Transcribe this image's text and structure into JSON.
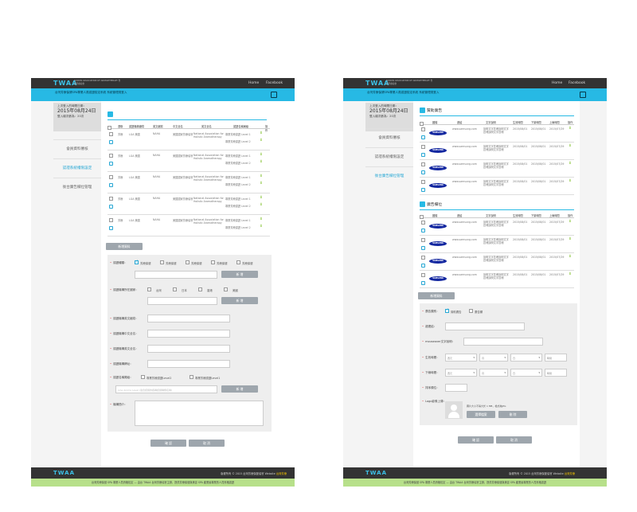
{
  "header": {
    "logo": "TWAA",
    "logo_sub": "TAIWAN ASSOCIATION OF AROMATHERAPY 台灣芳療協會",
    "nav": [
      "Home",
      "Facebook"
    ]
  },
  "left": {
    "subbar_text": "台灣芳療保健SPA專業人員認證檢定系統 系統管理員登入",
    "last_login_label": "上次登入的時間日期：",
    "last_login_date": "2015年08月24日",
    "visitors": "登入總次數為：20次",
    "side_items": [
      "會員資料審核",
      "認證系統權限設定",
      "後台廣告欄位管理"
    ],
    "table_headers": [
      "選取",
      "認證機構縮寫",
      "英文縮寫",
      "中文全名",
      "英文全名",
      "認證名稱屬級",
      "操作"
    ],
    "rows": [
      {
        "a": "芳療",
        "b": "LGA 美國",
        "c": "NAHA",
        "d": "美國國家芳療協會",
        "e": "National Association for Holistic Aromatherapy",
        "levels": [
          "專業芳療認證 Level 1",
          "專業芳療認證 Level 2"
        ]
      },
      {
        "a": "芳療",
        "b": "LGA 美國",
        "c": "NAHA",
        "d": "美國國家芳療協會",
        "e": "National Association for Holistic Aromatherapy",
        "levels": [
          "專業芳療認證 Level 1",
          "專業芳療認證 Level 2"
        ]
      },
      {
        "a": "芳療",
        "b": "LGA 美國",
        "c": "NAHA",
        "d": "美國國家芳療協會",
        "e": "National Association for Holistic Aromatherapy",
        "levels": [
          "專業芳療認證 Level 1",
          "專業芳療認證 Level 2"
        ]
      },
      {
        "a": "芳療",
        "b": "LGA 美國",
        "c": "NAHA",
        "d": "美國國家芳療協會",
        "e": "National Association for Holistic Aromatherapy",
        "levels": [
          "專業芳療認證 Level 1",
          "專業芳療認證 Level 2"
        ]
      },
      {
        "a": "芳療",
        "b": "LGA 美國",
        "c": "NAHA",
        "d": "美國國家芳療協會",
        "e": "National Association for Holistic Aromatherapy",
        "levels": [
          "專業芳療認證 Level 1",
          "專業芳療認證 Level 2"
        ]
      }
    ],
    "add_button": "新增資料",
    "form": {
      "type_label": "認證種類：",
      "type_options": [
        "芳療保健",
        "芳療保健",
        "芳療保健",
        "芳療保健",
        "芳療保健"
      ],
      "add": "新 增",
      "country_label": "認證機構所在國家：",
      "countries": [
        "台灣",
        "日本",
        "香港",
        "美國"
      ],
      "abbr_label": "認證機構英文縮寫：",
      "cn_label": "認證機構中文全名：",
      "en_label": "認證機構英文全名：",
      "site_label": "認證機構網址：",
      "level_label": "認證名稱屬級：",
      "levels": [
        "專業芳療認證Level2",
        "專業芳療認證Level1"
      ],
      "level_placeholder": "Line Aroma Level (適合認證的各種認證種類名稱)",
      "intro_label": "機構簡介：",
      "confirm": "確 認",
      "cancel": "取 消"
    },
    "footer_copy": "版權所有 © 2015 台灣芳療保健協會 Website",
    "footer_link": "台灣芳療",
    "green_text": "台灣芳療保健 SPA 專業人員資格檢定 — 由台 TWAA 台灣芳療協會主辦，提供芳療保健與美容 SPA 產業最專業的人員資格認證"
  },
  "right": {
    "subbar_text": "台灣芳療保健SPA專業人員認證檢定系統 系統管理員登入",
    "last_login_label": "上次登入的時間日期：",
    "last_login_date": "2015年08月24日",
    "visitors": "登入總次數為：20次",
    "side_items": [
      "會員資料審核",
      "認證系統權限設定",
      "後台廣告欄位管理"
    ],
    "sec1": "贊助廣告",
    "sec2": "廣告欄位",
    "table_headers": [
      "圖檔",
      "連結",
      "文字說明",
      "生效時間",
      "下架時間",
      "上線時間",
      "操作"
    ],
    "ad_url": "www.samsung.com",
    "ad_text": "說明文字區塊說明文字區塊說明文字區塊",
    "ad_start": "2015/08/01",
    "ad_end": "2015/07/29",
    "samsung": "SAMSUNG",
    "add_button": "新增資料",
    "form": {
      "type_label": "廣告類別：",
      "type_options": [
        "贊助廣告",
        "廣告欄"
      ],
      "link_label": "超連結：",
      "mouseover_label": "mouseover文字說明：",
      "start_label": "生效時間：",
      "end_label": "下線時間：",
      "order_label": "排序順位：",
      "logo_label": "Logo影像上傳：",
      "logo_note": "圖片大小不得大於 1 MB，格式為JPG",
      "select_file": "選擇檔案",
      "delete": "刪 除",
      "year": "西元",
      "month": "月",
      "day": "日",
      "time": "時間",
      "confirm": "確 認",
      "cancel": "取 消"
    },
    "footer_copy": "版權所有 © 2015 台灣芳療保健協會 Website",
    "footer_link": "台灣芳療",
    "green_text": "台灣芳療保健 SPA 專業人員資格檢定 — 由台 TWAA 台灣芳療協會主辦，提供芳療保健與美容 SPA 產業最專業的人員資格認證"
  }
}
